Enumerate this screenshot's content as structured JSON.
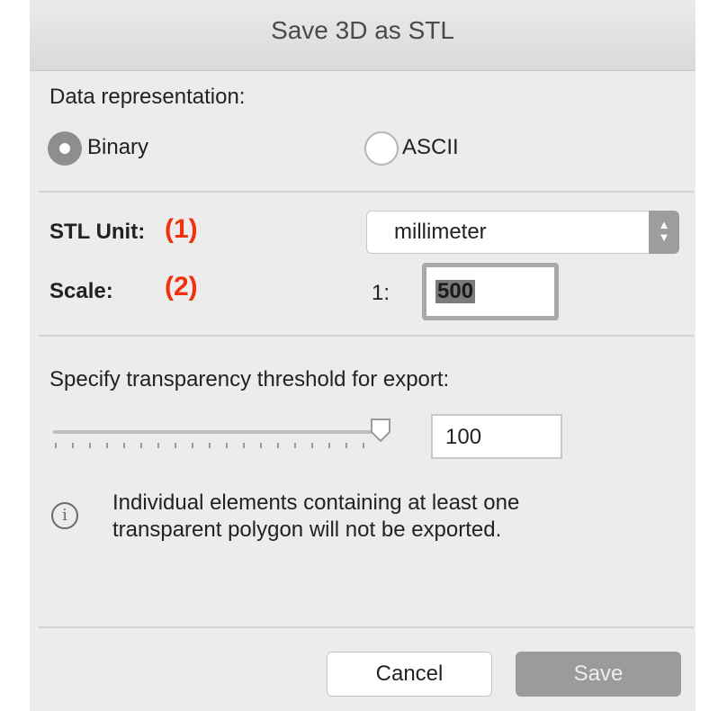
{
  "dialog": {
    "title": "Save 3D as STL",
    "data_representation_label": "Data representation:",
    "representation_options": [
      {
        "label": "Binary",
        "selected": true
      },
      {
        "label": "ASCII",
        "selected": false
      }
    ],
    "stl_unit_label": "STL Unit:",
    "stl_unit_annotation": "(1)",
    "stl_unit_value": "millimeter",
    "scale_label": "Scale:",
    "scale_annotation": "(2)",
    "scale_prefix": "1:",
    "scale_value": "500",
    "transparency_label": "Specify transparency threshold for export:",
    "transparency_value": "100",
    "transparency_slider_level": 100,
    "info_text_line1": "Individual elements containing at least one",
    "info_text_line2": "transparent polygon will not be exported.",
    "cancel_label": "Cancel",
    "save_label": "Save"
  },
  "colors": {
    "annotation": "#f0300f",
    "dialog_bg": "#ececec",
    "save_button_disabled": "#9b9b9b"
  },
  "icons": {
    "info": "info-circle-icon",
    "select_arrows": "chevron-updown-icon",
    "slider_knob": "slider-knob-icon"
  }
}
